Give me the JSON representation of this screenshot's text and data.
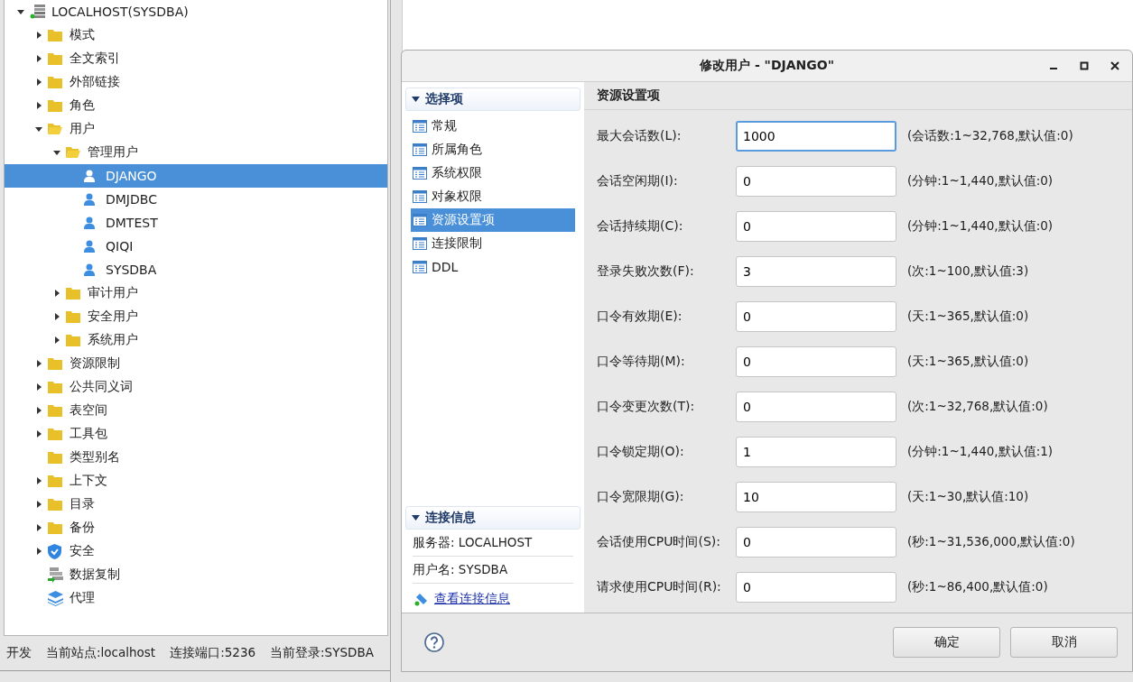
{
  "tree": [
    {
      "label": "LOCALHOST(SYSDBA)",
      "kind": "server",
      "expanded": true,
      "selected": false,
      "children": [
        {
          "label": "模式",
          "kind": "folder",
          "expanded": false,
          "selected": false
        },
        {
          "label": "全文索引",
          "kind": "folder",
          "expanded": false,
          "selected": false
        },
        {
          "label": "外部链接",
          "kind": "folder",
          "expanded": false,
          "selected": false
        },
        {
          "label": "角色",
          "kind": "folder",
          "expanded": false,
          "selected": false
        },
        {
          "label": "用户",
          "kind": "folder",
          "expanded": true,
          "selected": false,
          "children": [
            {
              "label": "管理用户",
              "kind": "folder",
              "expanded": true,
              "selected": false,
              "children": [
                {
                  "label": "DJANGO",
                  "kind": "user",
                  "selected": true
                },
                {
                  "label": "DMJDBC",
                  "kind": "user",
                  "selected": false
                },
                {
                  "label": "DMTEST",
                  "kind": "user",
                  "selected": false
                },
                {
                  "label": "QIQI",
                  "kind": "user",
                  "selected": false
                },
                {
                  "label": "SYSDBA",
                  "kind": "user",
                  "selected": false
                }
              ]
            },
            {
              "label": "审计用户",
              "kind": "folder",
              "expanded": false,
              "selected": false
            },
            {
              "label": "安全用户",
              "kind": "folder",
              "expanded": false,
              "selected": false
            },
            {
              "label": "系统用户",
              "kind": "folder",
              "expanded": false,
              "selected": false
            }
          ]
        },
        {
          "label": "资源限制",
          "kind": "folder",
          "expanded": false,
          "selected": false
        },
        {
          "label": "公共同义词",
          "kind": "folder",
          "expanded": false,
          "selected": false
        },
        {
          "label": "表空间",
          "kind": "folder",
          "expanded": false,
          "selected": false
        },
        {
          "label": "工具包",
          "kind": "folder",
          "expanded": false,
          "selected": false
        },
        {
          "label": "类型别名",
          "kind": "folder",
          "selected": false
        },
        {
          "label": "上下文",
          "kind": "folder",
          "expanded": false,
          "selected": false
        },
        {
          "label": "目录",
          "kind": "folder",
          "expanded": false,
          "selected": false
        },
        {
          "label": "备份",
          "kind": "folder",
          "expanded": false,
          "selected": false
        },
        {
          "label": "安全",
          "kind": "shield",
          "expanded": false,
          "selected": false
        },
        {
          "label": "数据复制",
          "kind": "replication",
          "selected": false
        },
        {
          "label": "代理",
          "kind": "layers",
          "selected": false
        }
      ]
    }
  ],
  "status_bar": [
    "开发",
    "当前站点:localhost",
    "连接端口:5236",
    "当前登录:SYSDBA"
  ],
  "dialog": {
    "title": "修改用户 - \"DJANGO\"",
    "options_header": "选择项",
    "options": [
      {
        "label": "常规",
        "selected": false
      },
      {
        "label": "所属角色",
        "selected": false
      },
      {
        "label": "系统权限",
        "selected": false
      },
      {
        "label": "对象权限",
        "selected": false
      },
      {
        "label": "资源设置项",
        "selected": true
      },
      {
        "label": "连接限制",
        "selected": false
      },
      {
        "label": "DDL",
        "selected": false
      }
    ],
    "connection_header": "连接信息",
    "connection": [
      "服务器: LOCALHOST",
      "用户名: SYSDBA"
    ],
    "connection_link": "查看连接信息",
    "section_title": "资源设置项",
    "fields": [
      {
        "label": "最大会话数(L):",
        "value": "1000",
        "hint": "(会话数:1~32,768,默认值:0)",
        "focused": true
      },
      {
        "label": "会话空闲期(I):",
        "value": "0",
        "hint": "(分钟:1~1,440,默认值:0)",
        "focused": false
      },
      {
        "label": "会话持续期(C):",
        "value": "0",
        "hint": "(分钟:1~1,440,默认值:0)",
        "focused": false
      },
      {
        "label": "登录失败次数(F):",
        "value": "3",
        "hint": "(次:1~100,默认值:3)",
        "focused": false
      },
      {
        "label": "口令有效期(E):",
        "value": "0",
        "hint": "(天:1~365,默认值:0)",
        "focused": false
      },
      {
        "label": "口令等待期(M):",
        "value": "0",
        "hint": "(天:1~365,默认值:0)",
        "focused": false
      },
      {
        "label": "口令变更次数(T):",
        "value": "0",
        "hint": "(次:1~32,768,默认值:0)",
        "focused": false
      },
      {
        "label": "口令锁定期(O):",
        "value": "1",
        "hint": "(分钟:1~1,440,默认值:1)",
        "focused": false
      },
      {
        "label": "口令宽限期(G):",
        "value": "10",
        "hint": "(天:1~30,默认值:10)",
        "focused": false
      },
      {
        "label": "会话使用CPU时间(S):",
        "value": "0",
        "hint": "(秒:1~31,536,000,默认值:0)",
        "focused": false
      },
      {
        "label": "请求使用CPU时间(R):",
        "value": "0",
        "hint": "(秒:1~86,400,默认值:0)",
        "focused": false
      }
    ],
    "buttons": [
      "确定",
      "取消"
    ]
  }
}
